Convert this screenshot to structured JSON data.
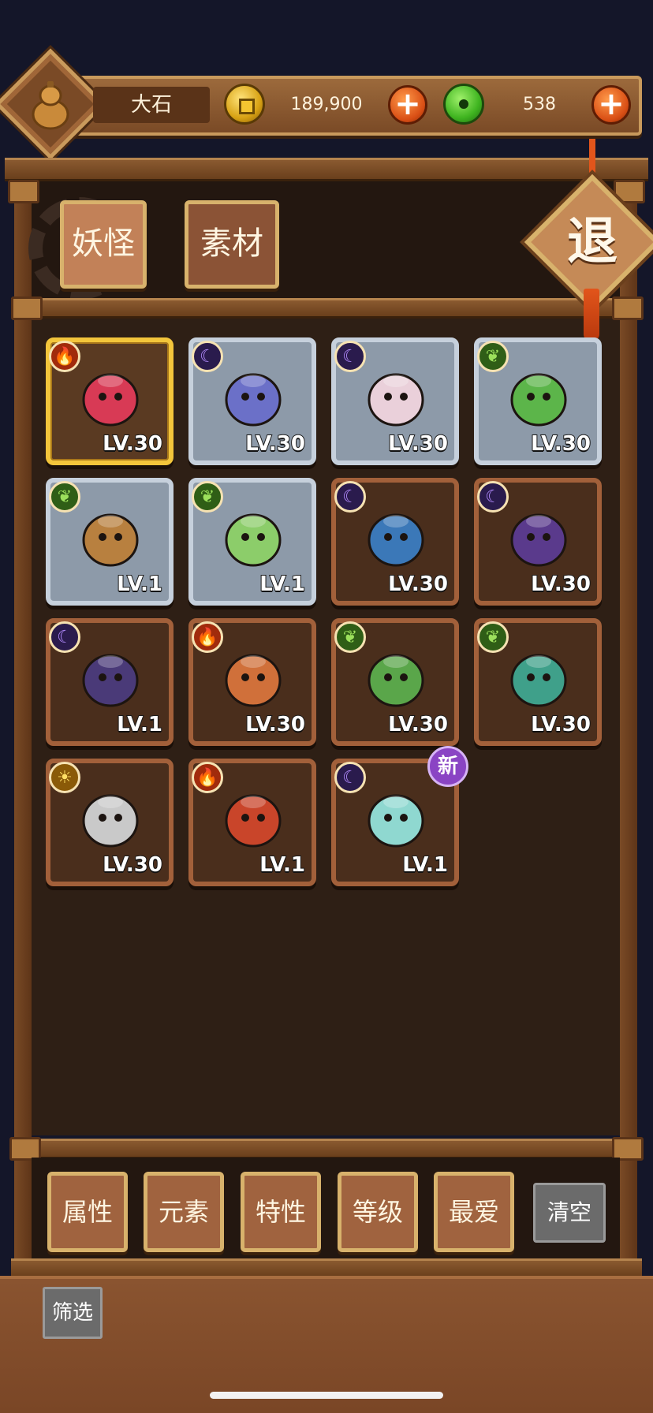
{
  "player": {
    "name": "大石"
  },
  "currency": {
    "coins": "189,900",
    "jade": "538",
    "add_symbol": "+"
  },
  "tabs": [
    {
      "label": "妖怪",
      "active": true
    },
    {
      "label": "素材",
      "active": false
    }
  ],
  "exit": {
    "label": "退"
  },
  "monsters": [
    {
      "element": "fire",
      "element_icon": "fire-icon",
      "rarity": "gold",
      "level": "LV.30",
      "art": "red-star-gem"
    },
    {
      "element": "moon",
      "element_icon": "moon-icon",
      "rarity": "silver",
      "level": "LV.30",
      "art": "talisman-scroll"
    },
    {
      "element": "moon",
      "element_icon": "moon-icon",
      "rarity": "silver",
      "level": "LV.30",
      "art": "pink-round-spirit"
    },
    {
      "element": "leaf",
      "element_icon": "leaf-icon",
      "rarity": "silver",
      "level": "LV.30",
      "art": "leek-sprite"
    },
    {
      "element": "leaf",
      "element_icon": "leaf-icon",
      "rarity": "silver",
      "level": "LV.1",
      "art": "sprout-stump"
    },
    {
      "element": "leaf",
      "element_icon": "leaf-icon",
      "rarity": "silver",
      "level": "LV.1",
      "art": "leaf-girl"
    },
    {
      "element": "moon",
      "element_icon": "moon-icon",
      "rarity": "bronze",
      "level": "LV.30",
      "art": "blue-bat-lantern"
    },
    {
      "element": "moon",
      "element_icon": "moon-icon",
      "rarity": "bronze",
      "level": "LV.30",
      "art": "purple-bean"
    },
    {
      "element": "moon",
      "element_icon": "moon-icon",
      "rarity": "bronze",
      "level": "LV.1",
      "art": "eye-twins"
    },
    {
      "element": "fire",
      "element_icon": "fire-icon",
      "rarity": "bronze",
      "level": "LV.30",
      "art": "burning-log"
    },
    {
      "element": "leaf",
      "element_icon": "leaf-icon",
      "rarity": "bronze",
      "level": "LV.30",
      "art": "green-beast"
    },
    {
      "element": "leaf",
      "element_icon": "leaf-icon",
      "rarity": "bronze",
      "level": "LV.30",
      "art": "cabbage-girl"
    },
    {
      "element": "sun",
      "element_icon": "sun-icon",
      "rarity": "bronze",
      "level": "LV.30",
      "art": "stone-tablet"
    },
    {
      "element": "fire",
      "element_icon": "fire-icon",
      "rarity": "bronze",
      "level": "LV.1",
      "art": "red-house"
    },
    {
      "element": "moon",
      "element_icon": "moon-icon",
      "rarity": "bronze",
      "level": "LV.1",
      "art": "teal-scroll",
      "badge": "新"
    }
  ],
  "filters": {
    "buttons": [
      "属性",
      "元素",
      "特性",
      "等级",
      "最爱"
    ],
    "clear_label": "清空",
    "screen_label": "筛选"
  },
  "colors": {
    "gold_frame": "#f3c53b",
    "silver_frame": "#c6d0dc",
    "bronze_frame": "#a2603a",
    "new_badge": "#8a44c4"
  }
}
